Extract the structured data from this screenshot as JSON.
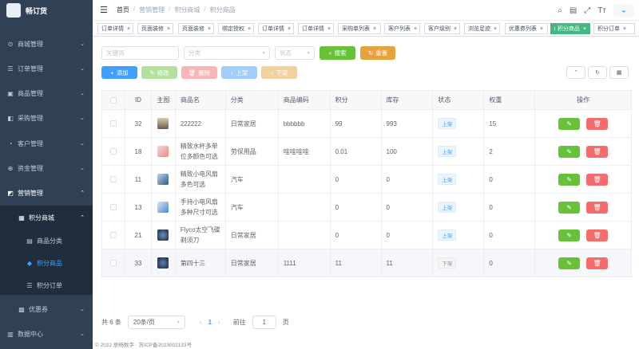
{
  "app": {
    "title": "畅订货"
  },
  "sidebar": {
    "items": [
      {
        "label": "商城管理"
      },
      {
        "label": "订单管理"
      },
      {
        "label": "商品管理"
      },
      {
        "label": "采购管理"
      },
      {
        "label": "客户管理"
      },
      {
        "label": "资金管理"
      },
      {
        "label": "营销管理"
      },
      {
        "label": "积分商城"
      },
      {
        "label": "商品分类"
      },
      {
        "label": "积分商品"
      },
      {
        "label": "积分订单"
      },
      {
        "label": "优惠券"
      },
      {
        "label": "数据中心"
      }
    ]
  },
  "breadcrumb": [
    "首页",
    "营销管理",
    "积分商城",
    "积分商品"
  ],
  "tags": [
    "订单详情",
    "页面装修",
    "页面装修",
    "绑定授权",
    "订单详情",
    "订单详情",
    "采购单列表",
    "客户列表",
    "客户级别",
    "浏览足迹",
    "优惠券列表",
    "积分商品",
    "积分订单"
  ],
  "filters": {
    "keyword_placeholder": "关键词",
    "category_placeholder": "分类",
    "status_placeholder": "状态",
    "search_label": "搜索",
    "reset_label": "重置"
  },
  "toolbar": {
    "add": "添加",
    "edit": "修改",
    "delete": "删除",
    "up": "上架",
    "down": "下架"
  },
  "table": {
    "headers": [
      "ID",
      "主图",
      "商品名",
      "分类",
      "商品编码",
      "积分",
      "库存",
      "状态",
      "权重",
      "操作"
    ],
    "rows": [
      {
        "id": "32",
        "name": "222222",
        "category": "日常家居",
        "code": "bbbbbb",
        "points": "99",
        "stock": "993",
        "status": "上架",
        "weight": "15"
      },
      {
        "id": "18",
        "name": "精致水杯多单位多颜色可选",
        "category": "劳保用品",
        "code": "哇哇哇哇",
        "points": "0.01",
        "stock": "100",
        "status": "上架",
        "weight": "2"
      },
      {
        "id": "11",
        "name": "精致小电风扇多色可选",
        "category": "汽车",
        "code": "",
        "points": "0",
        "stock": "0",
        "status": "上架",
        "weight": "0"
      },
      {
        "id": "13",
        "name": "手持小电风扇多种尺寸可选",
        "category": "汽车",
        "code": "",
        "points": "0",
        "stock": "0",
        "status": "上架",
        "weight": "0"
      },
      {
        "id": "21",
        "name": "Flyco太空飞碟剃须刀",
        "category": "日常家居",
        "code": "",
        "points": "0",
        "stock": "0",
        "status": "上架",
        "weight": "0"
      },
      {
        "id": "33",
        "name": "第四十三",
        "category": "日常家居",
        "code": "1111",
        "points": "11",
        "stock": "11",
        "status": "下架",
        "weight": "0"
      }
    ]
  },
  "pagination": {
    "total": "共 6 条",
    "page_size": "20条/页",
    "current": "1",
    "goto_label": "前往",
    "goto_value": "1",
    "page_unit": "页"
  },
  "footer": {
    "text": "© 2022 辰畅数字 · 苏ICP备2023002133号"
  },
  "colors": {
    "sidebar": "#304156",
    "primary": "#409eff",
    "success": "#67c23a",
    "warning": "#e6a23c",
    "danger": "#f56c6c",
    "tag_active": "#42b983"
  }
}
